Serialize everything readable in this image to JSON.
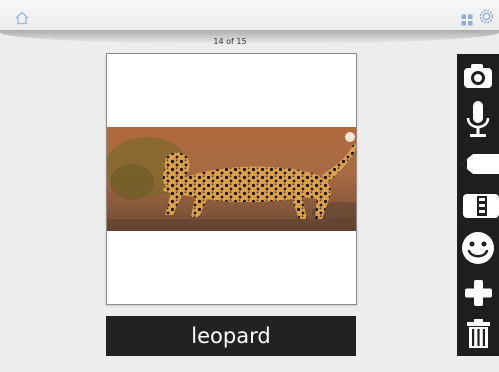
{
  "header": {
    "icons": [
      "home-icon",
      "grid-icon",
      "gear-icon"
    ],
    "page_indicator": "14 of 15"
  },
  "card": {
    "image": "leopard-photo",
    "caption": "leopard"
  },
  "toolbar": {
    "tools": [
      "camera-icon",
      "microphone-icon",
      "pencil-icon",
      "film-icon",
      "smiley-icon",
      "plus-icon",
      "trash-icon"
    ]
  },
  "colors": {
    "background": "#ededed",
    "caption_bar": "#222222",
    "toolbar": "#1e1e1e"
  }
}
